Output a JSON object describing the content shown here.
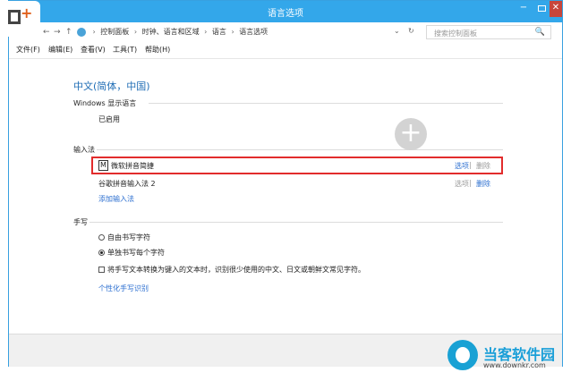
{
  "window": {
    "title": "语言选项"
  },
  "titlebar": {
    "min_glyph": "−",
    "close_glyph": "✕"
  },
  "nav": {
    "back": "←",
    "forward": "→",
    "up": "↑",
    "breadcrumbs": [
      "控制面板",
      "时钟、语言和区域",
      "语言",
      "语言选项"
    ],
    "sep": "›"
  },
  "address": {
    "dropdown_glyph": "⌄",
    "refresh_glyph": "↻"
  },
  "search": {
    "placeholder": "搜索控制面板",
    "icon": "🔍"
  },
  "menubar": [
    "文件(F)",
    "编辑(E)",
    "查看(V)",
    "工具(T)",
    "帮助(H)"
  ],
  "language": {
    "title": "中文(简体，中国)"
  },
  "display": {
    "heading": "Windows 显示语言",
    "status": "已启用"
  },
  "ime": {
    "heading": "输入法",
    "items": [
      {
        "icon": "M",
        "name": "微软拼音简捷",
        "options": "选项",
        "sep": "|",
        "remove": "删除"
      },
      {
        "name": "谷歌拼音输入法 2",
        "options": "选项",
        "sep": "|",
        "remove": "删除"
      }
    ],
    "add_link": "添加输入法"
  },
  "handwriting": {
    "heading": "手写",
    "options": [
      {
        "label": "自由书写字符",
        "selected": false
      },
      {
        "label": "单独书写每个字符",
        "selected": true
      }
    ],
    "checkbox": "将手写文本转换为键入的文本时，识别很少使用的中文、日文或朝鲜文常见字符。",
    "link": "个性化手写识别"
  },
  "overlay": {
    "plus": "+"
  },
  "watermark": {
    "name": "当客软件园",
    "url": "www.downkr.com"
  },
  "colors": {
    "titlebar": "#33a7ea",
    "link": "#2c6fd0",
    "highlight": "#e22c2c",
    "brand": "#1a9fd8"
  }
}
